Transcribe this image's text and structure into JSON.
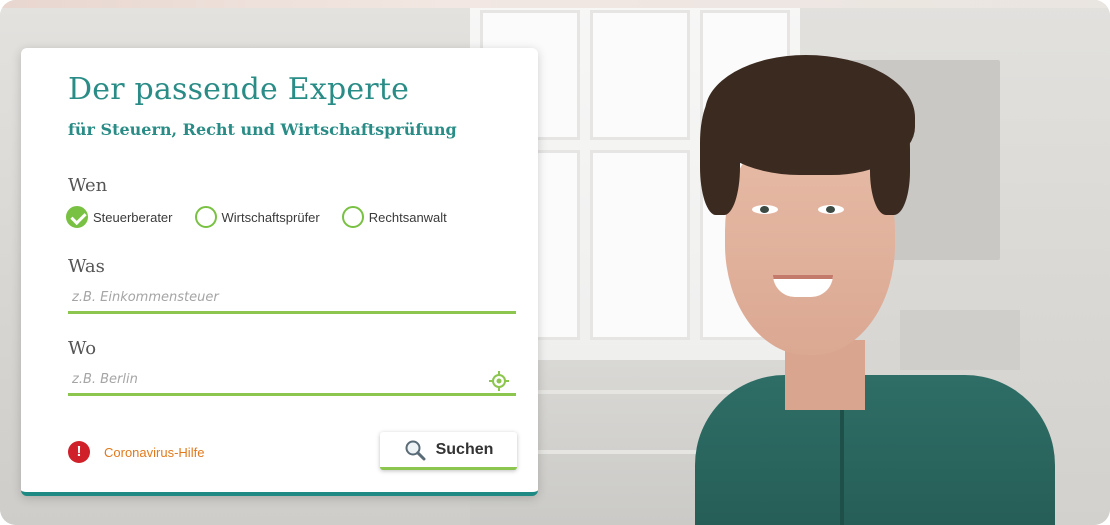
{
  "card": {
    "title": "Der passende Experte",
    "subtitle": "für Steuern, Recht und Wirtschaftsprüfung"
  },
  "wen": {
    "label": "Wen",
    "options": [
      {
        "label": "Steuerberater",
        "checked": true
      },
      {
        "label": "Wirtschaftsprüfer",
        "checked": false
      },
      {
        "label": "Rechtsanwalt",
        "checked": false
      }
    ]
  },
  "was": {
    "label": "Was",
    "placeholder": "z.B. Einkommensteuer",
    "value": ""
  },
  "wo": {
    "label": "Wo",
    "placeholder": "z.B. Berlin",
    "value": "",
    "locate_icon": "location-crosshair-icon"
  },
  "footer": {
    "corona_label": "Coronavirus-Hilfe",
    "corona_icon": "alert-icon",
    "search_label": "Suchen",
    "search_icon": "magnifier-icon"
  },
  "colors": {
    "brand_teal": "#2a8c86",
    "accent_green": "#8cc64e",
    "alert_red": "#d0202a",
    "link_orange": "#e27a1d"
  }
}
